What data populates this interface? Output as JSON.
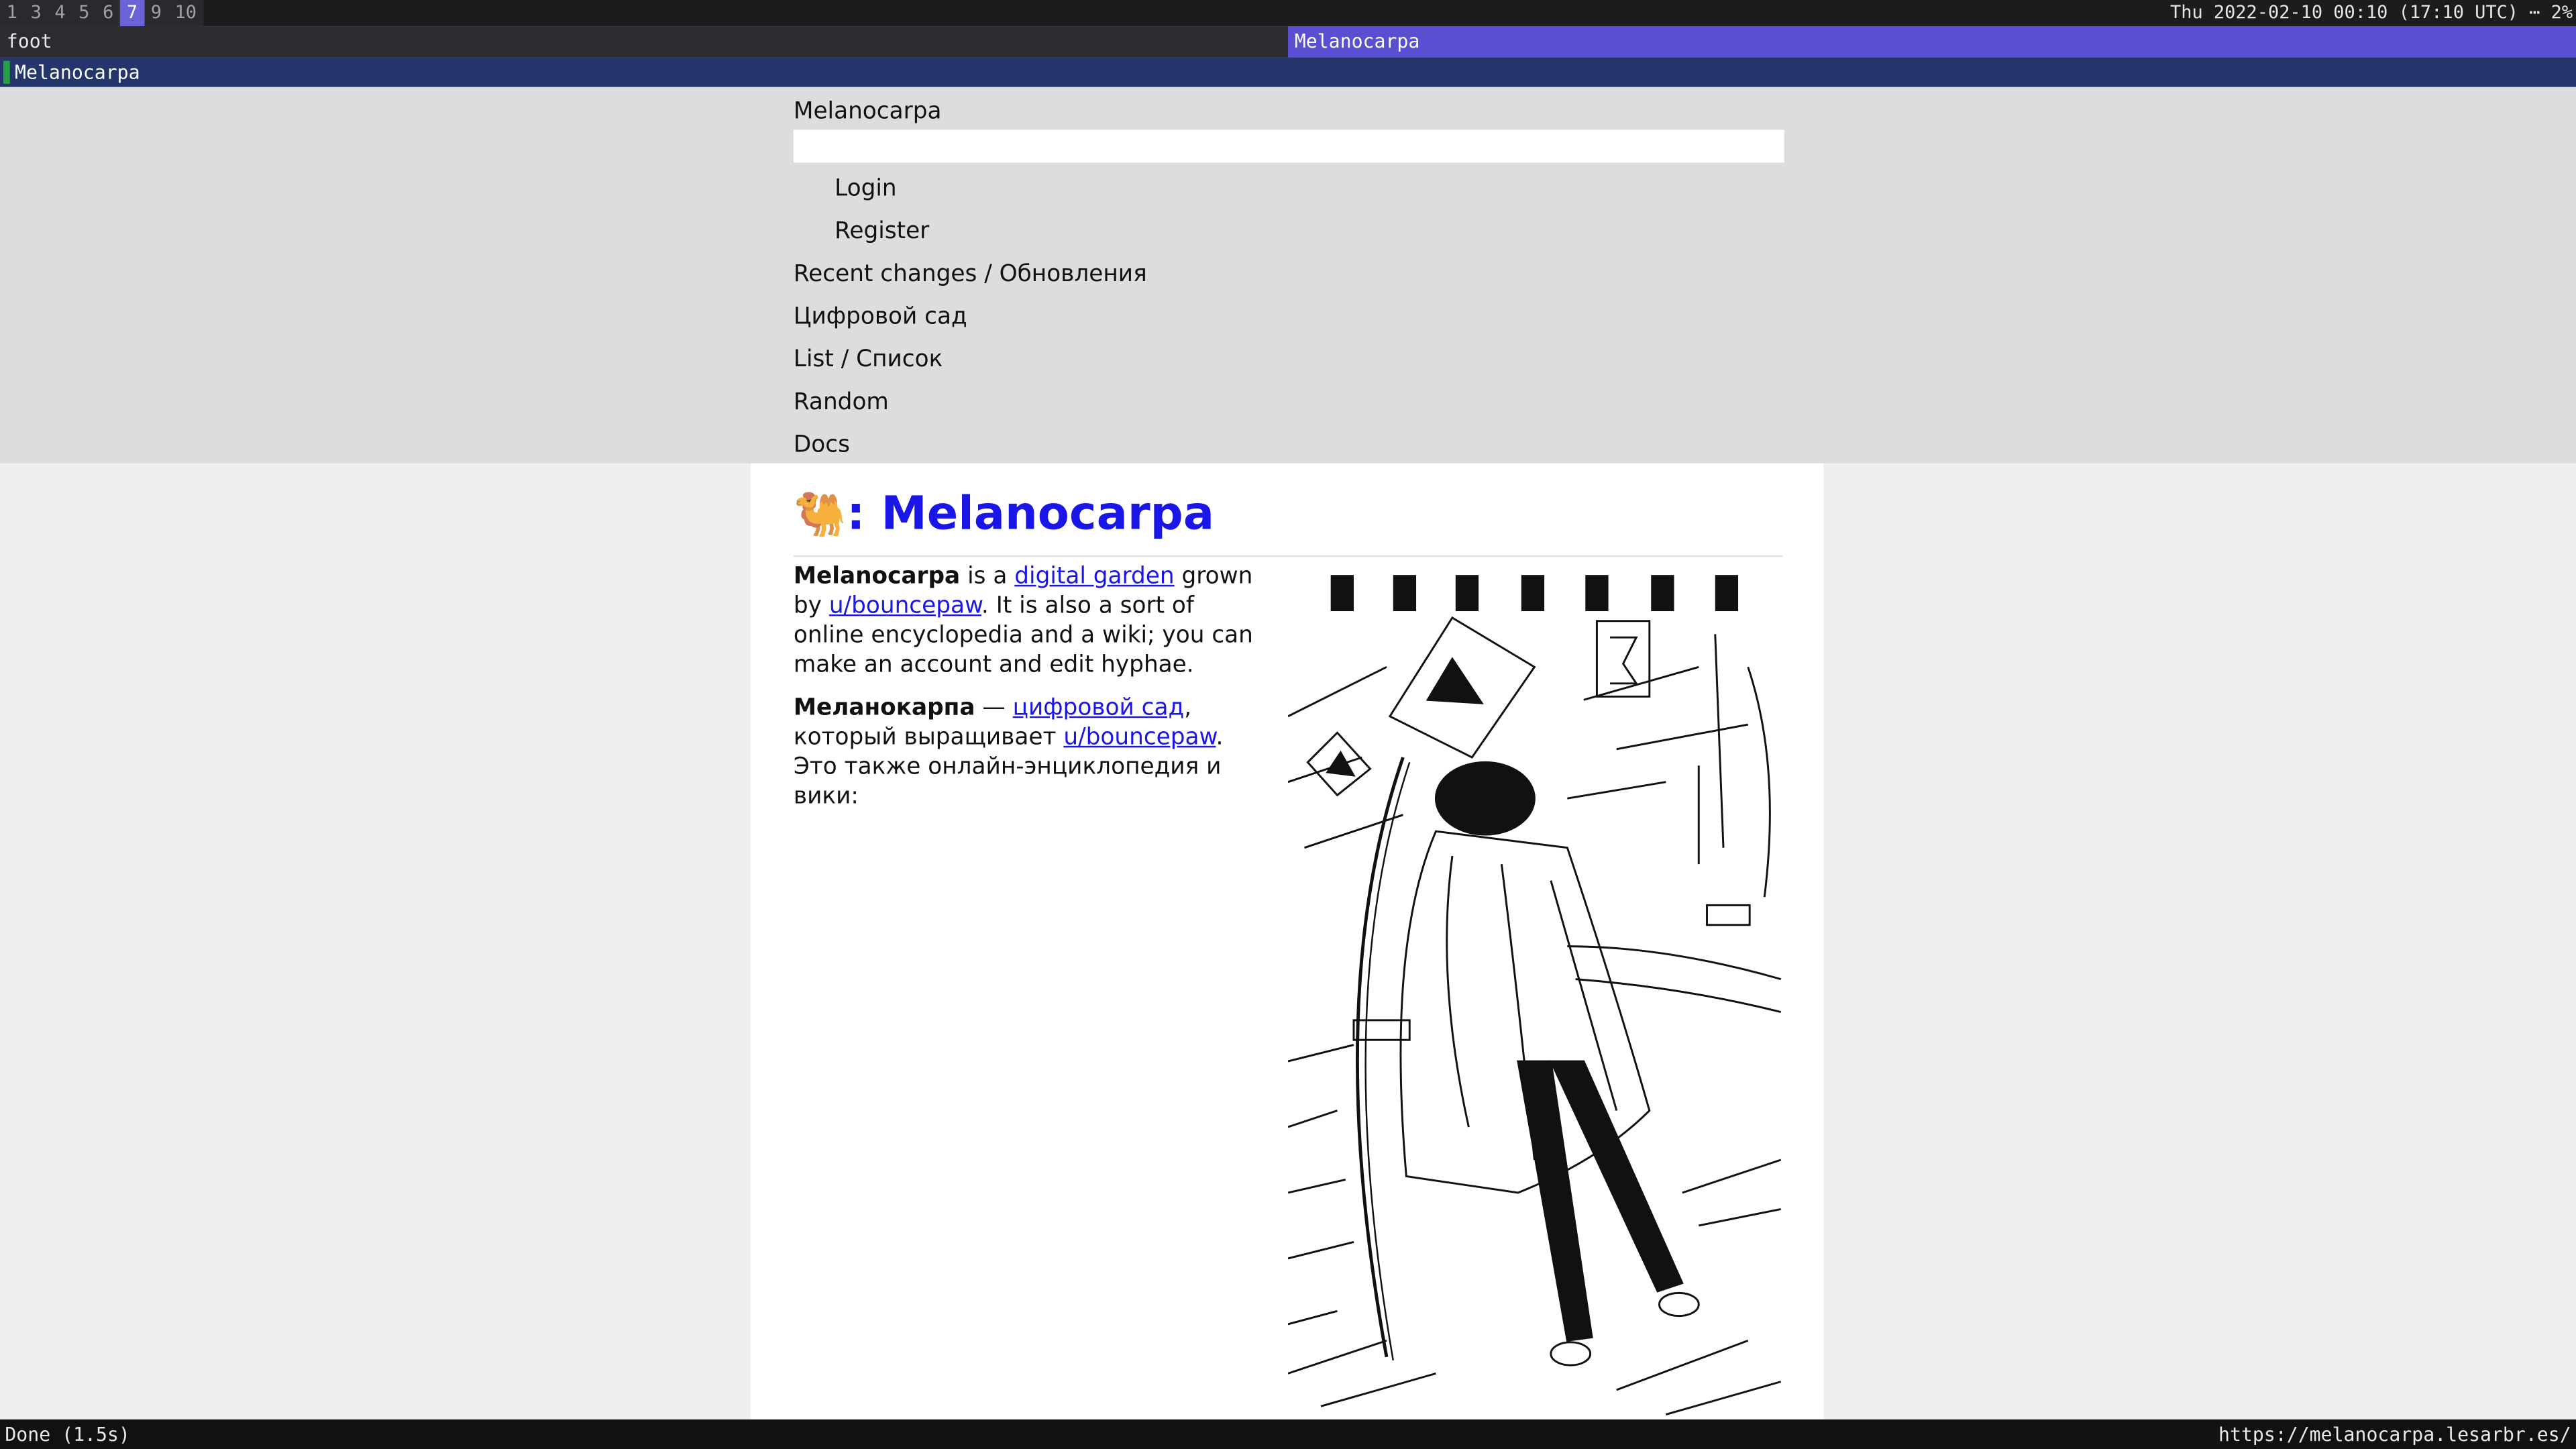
{
  "taskbar": {
    "workspaces": [
      "1",
      "3",
      "4",
      "5",
      "6",
      "7",
      "9",
      "10"
    ],
    "active_workspace": "7",
    "clock": "Thu 2022-02-10 00:10 (17:10 UTC) ⋯ 2%"
  },
  "windows": {
    "left_title": "foot",
    "right_title": "Melanocarpa"
  },
  "browser": {
    "tab_title": "Melanocarpa",
    "status_left": "Done (1.5s)",
    "status_url": "https://melanocarpa.lesarbr.es/"
  },
  "site": {
    "name": "Melanocarpa",
    "search_value": "",
    "auth_links": [
      "Login",
      "Register"
    ],
    "nav": [
      "Recent changes / Обновления",
      "Цифровой сад",
      "List / Список",
      "Random",
      "Docs"
    ]
  },
  "page": {
    "emoji": "🐫",
    "title_sep": ": ",
    "title": "Melanocarpa",
    "en": {
      "bold": "Melanocarpa",
      "t1": " is a ",
      "link1": "digital garden",
      "t2": " grown by ",
      "link2": "u/bouncepaw",
      "t3": ". It is also a sort of online encyclopedia and a wiki; you can make an account and edit hyphae."
    },
    "ru": {
      "bold": "Меланокарпа",
      "t1": " — ",
      "link1": "цифровой сад",
      "t2": ", который выращивает ",
      "link2": "u/bouncepaw",
      "t3": ". Это также онлайн-энциклопедия и вики:"
    }
  }
}
